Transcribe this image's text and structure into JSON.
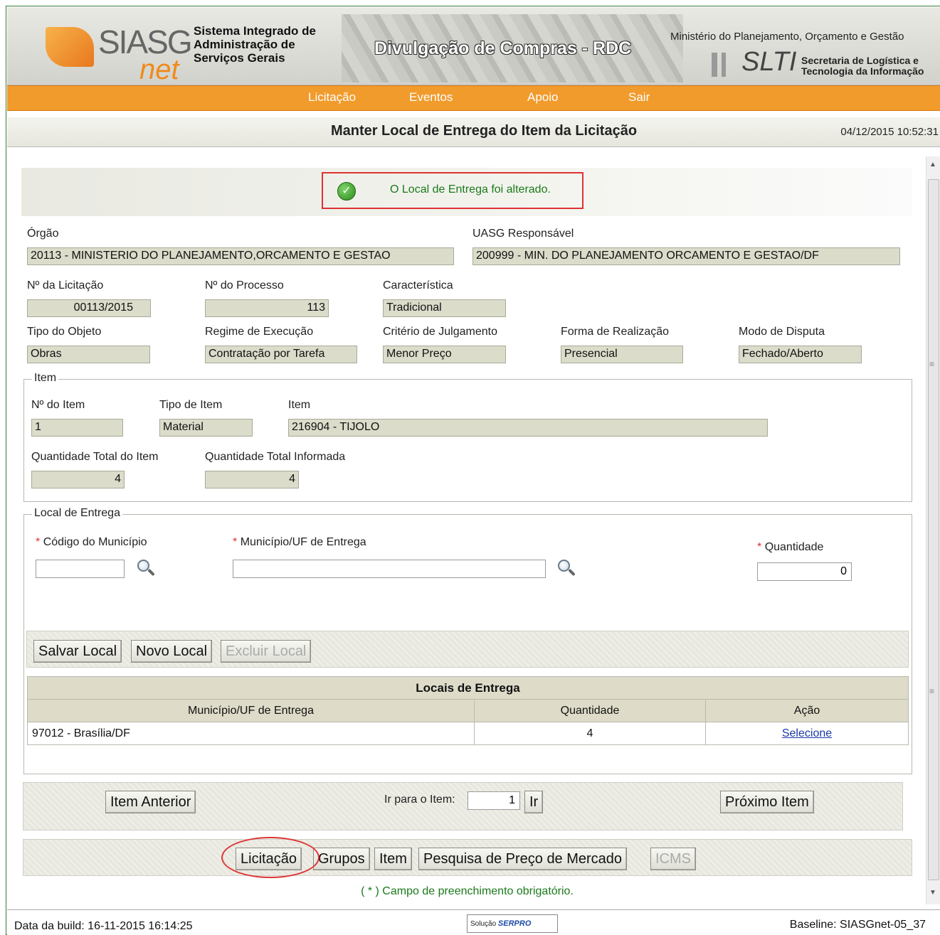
{
  "header": {
    "logo_text": "SIASG",
    "logo_sub": "net",
    "system_name": "Sistema Integrado de Administração de Serviços Gerais",
    "banner_title": "Divulgação de Compras - RDC",
    "ministry": "Ministério do Planejamento, Orçamento e Gestão",
    "slti": "SLTI",
    "slti_sub": "Secretaria de Logística e Tecnologia da Informação"
  },
  "nav": {
    "items": [
      "Licitação",
      "Eventos",
      "Apoio",
      "Sair"
    ]
  },
  "page": {
    "title": "Manter Local de Entrega do Item da Licitação",
    "datetime": "04/12/2015 10:52:31"
  },
  "message": "O Local de Entrega foi alterado.",
  "form": {
    "orgao_label": "Órgão",
    "orgao_value": "20113 - MINISTERIO DO PLANEJAMENTO,ORCAMENTO E GESTAO",
    "uasg_label": "UASG Responsável",
    "uasg_value": "200999 - MIN. DO PLANEJAMENTO ORCAMENTO E GESTAO/DF",
    "licitacao_label": "Nº da Licitação",
    "licitacao_value": "00113/2015",
    "processo_label": "Nº do Processo",
    "processo_value": "113",
    "caracteristica_label": "Característica",
    "caracteristica_value": "Tradicional",
    "tipo_objeto_label": "Tipo do Objeto",
    "tipo_objeto_value": "Obras",
    "regime_label": "Regime de Execução",
    "regime_value": "Contratação por Tarefa",
    "criterio_label": "Critério de Julgamento",
    "criterio_value": "Menor Preço",
    "forma_label": "Forma de Realização",
    "forma_value": "Presencial",
    "modo_label": "Modo de Disputa",
    "modo_value": "Fechado/Aberto"
  },
  "item": {
    "legend": "Item",
    "num_label": "Nº do Item",
    "num_value": "1",
    "tipo_label": "Tipo de Item",
    "tipo_value": "Material",
    "item_label": "Item",
    "item_value": "216904 - TIJOLO",
    "qtd_total_label": "Quantidade Total do Item",
    "qtd_total_value": "4",
    "qtd_info_label": "Quantidade Total Informada",
    "qtd_info_value": "4"
  },
  "local": {
    "legend": "Local de Entrega",
    "required_mark": "*",
    "codigo_label": "Código do Município",
    "codigo_value": "",
    "municipio_label": "Município/UF de Entrega",
    "municipio_value": "",
    "quantidade_label": "Quantidade",
    "quantidade_value": "0",
    "buttons": {
      "salvar": "Salvar Local",
      "novo": "Novo Local",
      "excluir": "Excluir Local"
    }
  },
  "table": {
    "caption": "Locais de Entrega",
    "headers": [
      "Município/UF de Entrega",
      "Quantidade",
      "Ação"
    ],
    "rows": [
      {
        "municipio": "97012 - Brasília/DF",
        "quantidade": "4",
        "acao": "Selecione"
      }
    ]
  },
  "navigation": {
    "anterior": "Item Anterior",
    "ir_label": "Ir para o Item:",
    "ir_value": "1",
    "ir_button": "Ir",
    "proximo": "Próximo Item"
  },
  "bottom_tabs": [
    "Licitação",
    "Grupos",
    "Item",
    "Pesquisa de Preço de Mercado",
    "ICMS"
  ],
  "required_note": "( * ) Campo de preenchimento obrigatório.",
  "footer": {
    "build": "Data da build: 16-11-2015 16:14:25",
    "solucao": "Solução",
    "serpro": "SERPRO",
    "baseline": "Baseline: SIASGnet-05_37"
  }
}
